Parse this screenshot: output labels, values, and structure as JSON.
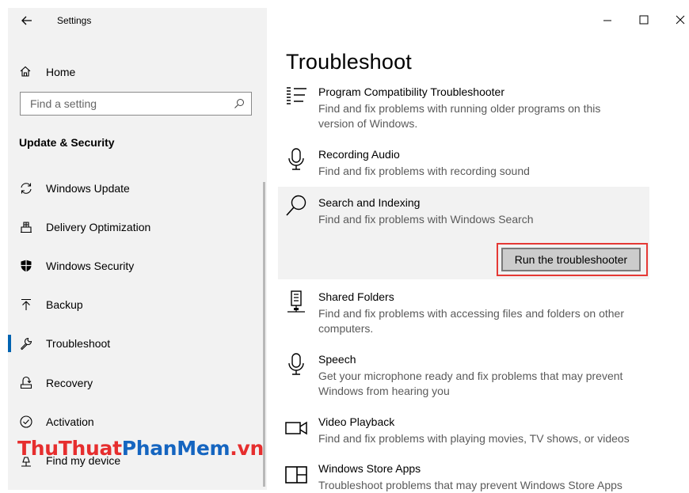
{
  "app": {
    "title": "Settings"
  },
  "window_controls": {
    "minimize_icon": "minimize-icon",
    "maximize_icon": "maximize-icon",
    "close_icon": "close-icon"
  },
  "sidebar": {
    "home_label": "Home",
    "search": {
      "placeholder": "Find a setting",
      "value": ""
    },
    "section_header": "Update & Security",
    "items": [
      {
        "label": "Windows Update",
        "icon": "sync-icon",
        "selected": false
      },
      {
        "label": "Delivery Optimization",
        "icon": "delivery-optimization-icon",
        "selected": false
      },
      {
        "label": "Windows Security",
        "icon": "shield-icon",
        "selected": false
      },
      {
        "label": "Backup",
        "icon": "backup-arrow-icon",
        "selected": false
      },
      {
        "label": "Troubleshoot",
        "icon": "wrench-icon",
        "selected": true
      },
      {
        "label": "Recovery",
        "icon": "recovery-icon",
        "selected": false
      },
      {
        "label": "Activation",
        "icon": "check-circle-icon",
        "selected": false
      },
      {
        "label": "Find my device",
        "icon": "find-device-icon",
        "selected": false
      }
    ]
  },
  "watermark": {
    "part1": "ThuThuat",
    "part2": "PhanMem",
    "part3": ".vn"
  },
  "main": {
    "title": "Troubleshoot",
    "items": [
      {
        "name": "Program Compatibility Troubleshooter",
        "desc": "Find and fix problems with running older programs on this version of Windows.",
        "icon": "list-icon"
      },
      {
        "name": "Recording Audio",
        "desc": "Find and fix problems with recording sound",
        "icon": "microphone-icon"
      },
      {
        "name": "Search and Indexing",
        "desc": "Find and fix problems with Windows Search",
        "icon": "search-icon"
      },
      {
        "name": "Shared Folders",
        "desc": "Find and fix problems with accessing files and folders on other computers.",
        "icon": "shared-folders-icon"
      },
      {
        "name": "Speech",
        "desc": "Get your microphone ready and fix problems that may prevent Windows from hearing you",
        "icon": "microphone-icon"
      },
      {
        "name": "Video Playback",
        "desc": "Find and fix problems with playing movies, TV shows, or videos",
        "icon": "video-camera-icon"
      },
      {
        "name": "Windows Store Apps",
        "desc": "Troubleshoot problems that may prevent Windows Store Apps",
        "icon": "store-apps-icon"
      }
    ],
    "run_button_label": "Run the troubleshooter",
    "accent_color": "#0063b1",
    "highlight_color": "#e53935"
  }
}
